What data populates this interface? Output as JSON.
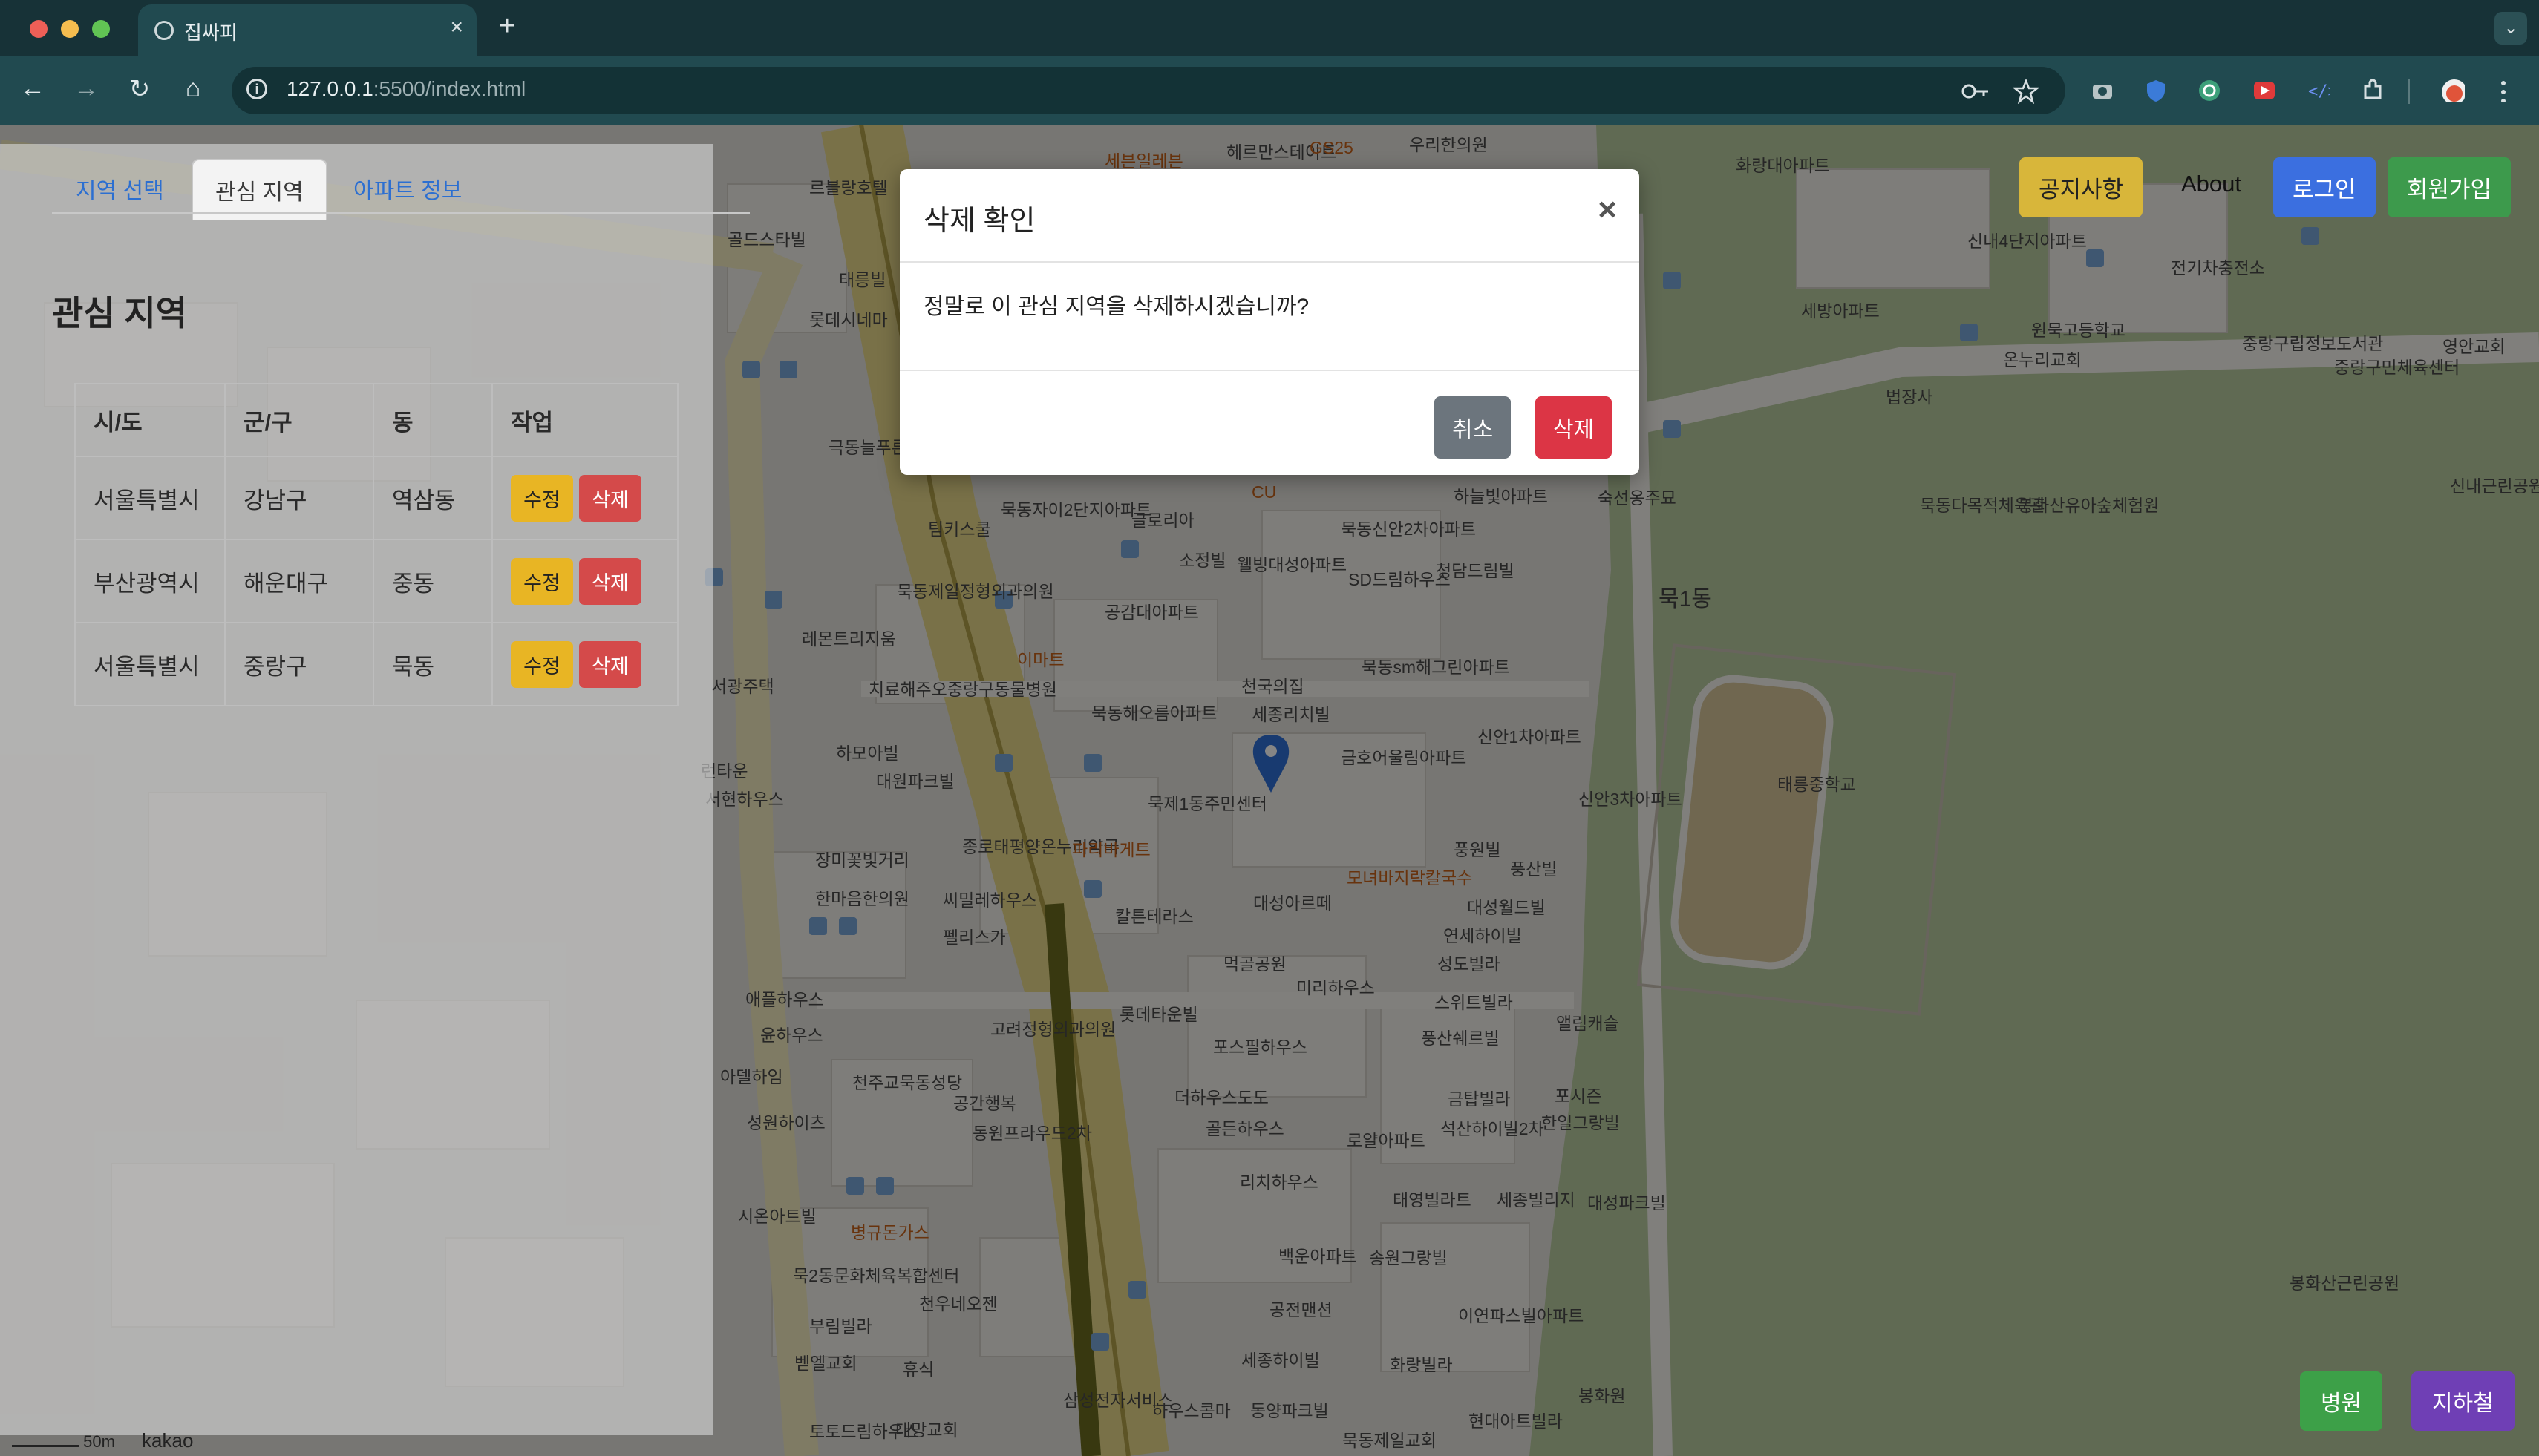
{
  "browser": {
    "tab_title": "집싸피",
    "new_tab": "+",
    "tab_close": "×",
    "tab_dropdown": "⌄",
    "url_host": "127.0.0.1",
    "url_path": ":5500/index.html",
    "nav": {
      "back": "←",
      "forward": "→",
      "reload": "↻",
      "home": "⌂"
    },
    "icons": [
      "key-icon",
      "star-icon",
      "camera-icon",
      "shield-icon",
      "extension-icon",
      "puzzle-icon",
      "profile-icon",
      "menu-icon"
    ]
  },
  "panel": {
    "tabs": [
      "지역 선택",
      "관심 지역",
      "아파트 정보"
    ],
    "active_tab": "관심 지역",
    "title": "관심 지역",
    "columns": [
      "시/도",
      "군/구",
      "동",
      "작업"
    ],
    "rows": [
      {
        "sido": "서울특별시",
        "gugun": "강남구",
        "dong": "역삼동"
      },
      {
        "sido": "부산광역시",
        "gugun": "해운대구",
        "dong": "중동"
      },
      {
        "sido": "서울특별시",
        "gugun": "중랑구",
        "dong": "묵동"
      }
    ],
    "edit_label": "수정",
    "delete_label": "삭제"
  },
  "topnav": {
    "notice": "공지사항",
    "about": "About",
    "login": "로그인",
    "signup": "회원가입"
  },
  "bottom": {
    "hospital": "병원",
    "subway": "지하철"
  },
  "map": {
    "scale": "50m",
    "provider": "kakao",
    "labels": [
      "르블랑호텔",
      "골드스타빌",
      "태릉빌",
      "롯데시네마",
      "극동늘푸른아파트",
      "팀키스쿨",
      "묵동자이2단지아파트",
      "글로리아",
      "묵동제일정형외과의원",
      "레몬트리지움",
      "이마트",
      "공감대아파트",
      "소정빌",
      "웰빙대성아파트",
      "SD드림하우스",
      "묵동신안2차아파트",
      "청담드림빌",
      "하늘빛아파트",
      "천국의집",
      "세종리치빌",
      "금호어울림아파트",
      "신안1차아파트",
      "신안3차아파트",
      "묵동sm해그린아파트",
      "치료해주오중랑구동물병원",
      "묵동해오름아파트",
      "하모아빌",
      "대원파크빌",
      "묵제1동주민센터",
      "종로태평양온누리약국",
      "파리바게트",
      "모녀바지락칼국수",
      "풍원빌",
      "풍산빌",
      "장미꽃빛거리",
      "한마음한의원",
      "씨밀레하우스",
      "칼튼테라스",
      "대성아르떼",
      "대성월드빌",
      "연세하이빌",
      "성도빌라",
      "펠리스가",
      "먹골공원",
      "미리하우스",
      "스위트빌라",
      "애플하우스",
      "롯데타운빌",
      "윤하우스",
      "고려정형외과의원",
      "포스필하우스",
      "풍산쉐르빌",
      "앨림캐슬",
      "아델하임",
      "천주교묵동성당",
      "공간행복",
      "더하우스도도",
      "골든하우스",
      "금탑빌라",
      "석산하이빌2차",
      "포시즌",
      "한일그랑빌",
      "성원하이츠",
      "동원프라우드2차",
      "로얄아파트",
      "리치하우스",
      "태영빌라트",
      "세종빌리지",
      "대성파크빌",
      "시온아트빌",
      "백운아파트",
      "송원그랑빌",
      "병규돈가스",
      "묵2동문화체육복합센터",
      "천우네오젠",
      "공전맨션",
      "이연파스빌아파트",
      "부림빌라",
      "세종하이빌",
      "화랑빌라",
      "벧엘교회",
      "휴식",
      "삼성전자서비스",
      "하우스콤마",
      "동양파크빌",
      "묵동제일교회",
      "현대아트빌라",
      "대망교회",
      "토토드림하우스",
      "태릉중학교",
      "묵1동",
      "원묵고등학교",
      "온누리교회",
      "법장사",
      "묵동다목적체육관",
      "봉화산유아숲체험원",
      "숙선옹주묘",
      "신내4단지아파트",
      "세방아파트",
      "화랑대아파트",
      "전기차충전소",
      "중랑구립정보도서관",
      "중랑구민체육센터",
      "영안교회",
      "신내근린공원",
      "봉화산근린공원",
      "봉화원",
      "서광주택",
      "서현하우스",
      "런타운",
      "우리한의원",
      "세븐일레븐",
      "헤르만스테이트",
      "GS25",
      "CU"
    ]
  },
  "modal": {
    "title": "삭제 확인",
    "close": "×",
    "message": "정말로 이 관심 지역을 삭제하시겠습니까?",
    "cancel": "취소",
    "delete": "삭제"
  },
  "colors": {
    "chrome": "#214a50",
    "link": "#2c6fd1",
    "edit": "#e8b524",
    "danger": "#dc3545",
    "secondary": "#6c757d",
    "login": "#3b6fe0",
    "signup": "#3d9a4c",
    "subway": "#6f3fb5",
    "marker": "#2f6fd6"
  }
}
